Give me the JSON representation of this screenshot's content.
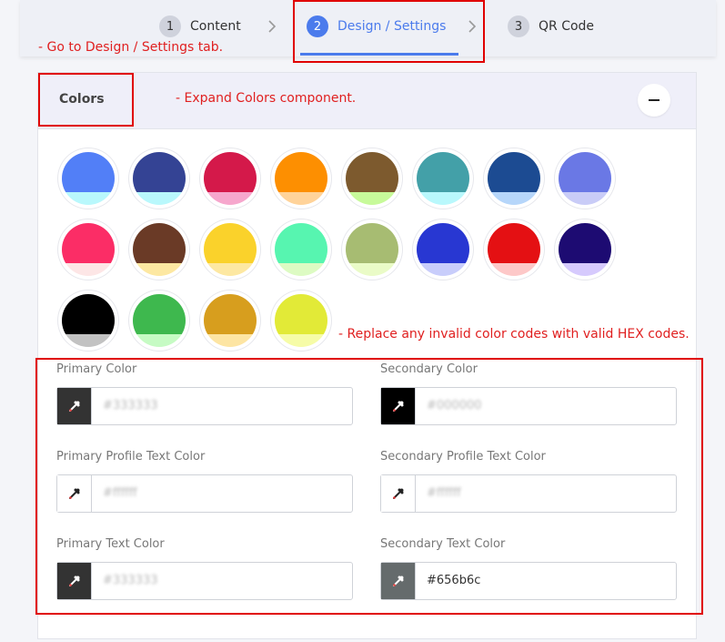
{
  "stepper": {
    "steps": [
      {
        "num": "1",
        "label": "Content"
      },
      {
        "num": "2",
        "label": "Design / Settings"
      },
      {
        "num": "3",
        "label": "QR Code"
      }
    ]
  },
  "annotations": {
    "goto_tab": "- Go to Design / Settings tab.",
    "expand_colors": "- Expand Colors component.",
    "replace_codes": "- Replace any invalid color codes with valid HEX codes."
  },
  "colors_panel": {
    "title": "Colors",
    "swatches": [
      {
        "top": "#527ff7",
        "bottom": "#b9f8fc"
      },
      {
        "top": "#344394",
        "bottom": "#b9f8fc"
      },
      {
        "top": "#d4194a",
        "bottom": "#f6a7cd"
      },
      {
        "top": "#fd8f01",
        "bottom": "#ffd39a"
      },
      {
        "top": "#7d5a2e",
        "bottom": "#c7fa9a"
      },
      {
        "top": "#43a0a8",
        "bottom": "#b9f8fc"
      },
      {
        "top": "#1c4b92",
        "bottom": "#b6d6fa"
      },
      {
        "top": "#6a78e5",
        "bottom": "#c9ccf7"
      },
      {
        "top": "#fb2d66",
        "bottom": "#fde6e6"
      },
      {
        "top": "#6a3a26",
        "bottom": "#fde8a2"
      },
      {
        "top": "#fad22b",
        "bottom": "#fde8a2"
      },
      {
        "top": "#57f5b0",
        "bottom": "#ddfbc3"
      },
      {
        "top": "#a7bc72",
        "bottom": "#eafbc7"
      },
      {
        "top": "#2837d2",
        "bottom": "#c8cdfb"
      },
      {
        "top": "#e41013",
        "bottom": "#fdc8c8"
      },
      {
        "top": "#1d0b72",
        "bottom": "#d6cafd"
      },
      {
        "top": "#000000",
        "bottom": "#c2c2c2"
      },
      {
        "top": "#3eb84e",
        "bottom": "#c6fbc4"
      },
      {
        "top": "#d79e1e",
        "bottom": "#fde5a3"
      },
      {
        "top": "#e2ea37",
        "bottom": "#f6fca7"
      }
    ],
    "fields": [
      {
        "label": "Primary Color",
        "value": "#333333",
        "picker_color": "#333333",
        "icon": "eyedropper-icon"
      },
      {
        "label": "Secondary Color",
        "value": "#000000",
        "picker_color": "#000000",
        "icon": "eyedropper-icon"
      },
      {
        "label": "Primary Profile Text Color",
        "value": "#ffffff",
        "picker_color": "#ffffff",
        "icon": "eyedropper-icon"
      },
      {
        "label": "Secondary Profile Text Color",
        "value": "#ffffff",
        "picker_color": "#ffffff",
        "icon": "eyedropper-icon"
      },
      {
        "label": "Primary Text Color",
        "value": "#333333",
        "picker_color": "#333333",
        "icon": "eyedropper-icon"
      },
      {
        "label": "Secondary Text Color",
        "value": "#656b6c",
        "picker_color": "#656b6c",
        "icon": "eyedropper-icon"
      }
    ]
  },
  "colors": {
    "accent": "#4b7bec",
    "annotation_red": "#e00000"
  }
}
